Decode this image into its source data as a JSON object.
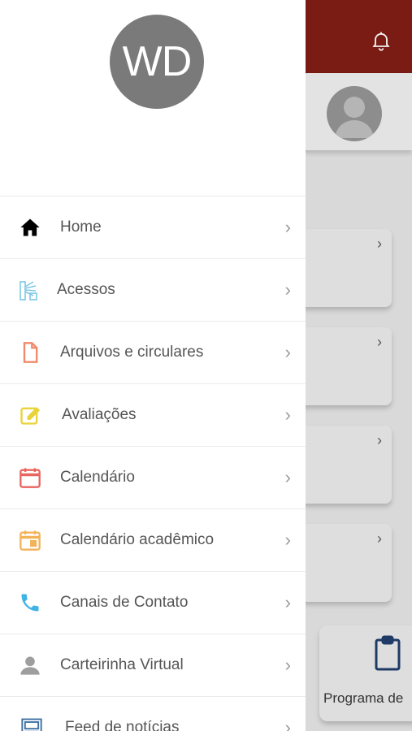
{
  "user": {
    "initials": "WD"
  },
  "menu": {
    "items": [
      {
        "label": "Home",
        "icon": "home-icon",
        "color": "#000000"
      },
      {
        "label": "Acessos",
        "icon": "turnstile-icon",
        "color": "#7fc7e6"
      },
      {
        "label": "Arquivos e circulares",
        "icon": "document-icon",
        "color": "#f08a6a"
      },
      {
        "label": "Avaliações",
        "icon": "edit-icon",
        "color": "#e9d33a"
      },
      {
        "label": "Calendário",
        "icon": "calendar-icon",
        "color": "#e9645e"
      },
      {
        "label": "Calendário acadêmico",
        "icon": "calendar-event-icon",
        "color": "#f2b35a"
      },
      {
        "label": "Canais de Contato",
        "icon": "phone-icon",
        "color": "#3fb3e6"
      },
      {
        "label": "Carteirinha Virtual",
        "icon": "person-icon",
        "color": "#9e9e9e"
      },
      {
        "label": "Feed de notícias",
        "icon": "news-icon",
        "color": "#3b6fa3"
      }
    ]
  },
  "background": {
    "header_color": "#7a1b14",
    "bottom_card_label": "Programa de"
  }
}
